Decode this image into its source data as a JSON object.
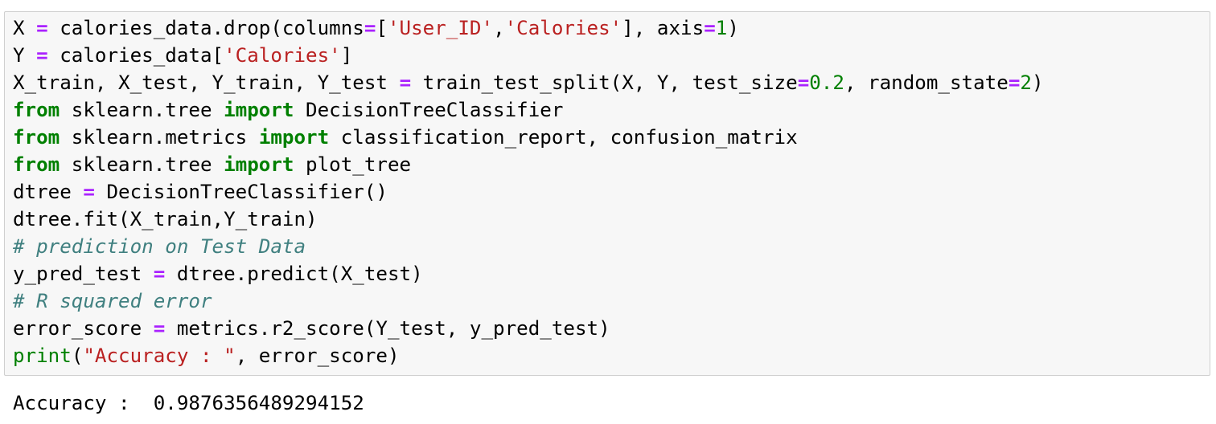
{
  "cell": {
    "lines": [
      [
        {
          "t": "X ",
          "c": ""
        },
        {
          "t": "=",
          "c": "op"
        },
        {
          "t": " calories_data.drop(columns",
          "c": ""
        },
        {
          "t": "=",
          "c": "op"
        },
        {
          "t": "[",
          "c": ""
        },
        {
          "t": "'User_ID'",
          "c": "str"
        },
        {
          "t": ",",
          "c": ""
        },
        {
          "t": "'Calories'",
          "c": "str"
        },
        {
          "t": "], axis",
          "c": ""
        },
        {
          "t": "=",
          "c": "op"
        },
        {
          "t": "1",
          "c": "num"
        },
        {
          "t": ")",
          "c": ""
        }
      ],
      [
        {
          "t": "Y ",
          "c": ""
        },
        {
          "t": "=",
          "c": "op"
        },
        {
          "t": " calories_data[",
          "c": ""
        },
        {
          "t": "'Calories'",
          "c": "str"
        },
        {
          "t": "]",
          "c": ""
        }
      ],
      [
        {
          "t": "X_train, X_test, Y_train, Y_test ",
          "c": ""
        },
        {
          "t": "=",
          "c": "op"
        },
        {
          "t": " train_test_split(X, Y, test_size",
          "c": ""
        },
        {
          "t": "=",
          "c": "op"
        },
        {
          "t": "0.2",
          "c": "num"
        },
        {
          "t": ", random_state",
          "c": ""
        },
        {
          "t": "=",
          "c": "op"
        },
        {
          "t": "2",
          "c": "num"
        },
        {
          "t": ")",
          "c": ""
        }
      ],
      [
        {
          "t": "from",
          "c": "kw"
        },
        {
          "t": " sklearn.tree ",
          "c": ""
        },
        {
          "t": "import",
          "c": "kw"
        },
        {
          "t": " DecisionTreeClassifier",
          "c": ""
        }
      ],
      [
        {
          "t": "from",
          "c": "kw"
        },
        {
          "t": " sklearn.metrics ",
          "c": ""
        },
        {
          "t": "import",
          "c": "kw"
        },
        {
          "t": " classification_report, confusion_matrix",
          "c": ""
        }
      ],
      [
        {
          "t": "from",
          "c": "kw"
        },
        {
          "t": " sklearn.tree ",
          "c": ""
        },
        {
          "t": "import",
          "c": "kw"
        },
        {
          "t": " plot_tree",
          "c": ""
        }
      ],
      [
        {
          "t": "dtree ",
          "c": ""
        },
        {
          "t": "=",
          "c": "op"
        },
        {
          "t": " DecisionTreeClassifier()",
          "c": ""
        }
      ],
      [
        {
          "t": "dtree.fit(X_train,Y_train)",
          "c": ""
        }
      ],
      [
        {
          "t": "# prediction on Test Data",
          "c": "cm"
        }
      ],
      [
        {
          "t": "y_pred_test ",
          "c": ""
        },
        {
          "t": "=",
          "c": "op"
        },
        {
          "t": " dtree.predict(X_test)",
          "c": ""
        }
      ],
      [
        {
          "t": "# R squared error",
          "c": "cm"
        }
      ],
      [
        {
          "t": "error_score ",
          "c": ""
        },
        {
          "t": "=",
          "c": "op"
        },
        {
          "t": " metrics.r2_score(Y_test, y_pred_test)",
          "c": ""
        }
      ],
      [
        {
          "t": "print",
          "c": "bi"
        },
        {
          "t": "(",
          "c": ""
        },
        {
          "t": "\"Accuracy : \"",
          "c": "str"
        },
        {
          "t": ", error_score)",
          "c": ""
        }
      ]
    ]
  },
  "output": {
    "text": "Accuracy :  0.9876356489294152"
  },
  "colors": {
    "keyword": "#008000",
    "operator": "#aa22ff",
    "string": "#ba2121",
    "number": "#008000",
    "comment": "#408080",
    "cell_background": "#f7f7f7",
    "cell_border": "#cfcfcf"
  }
}
